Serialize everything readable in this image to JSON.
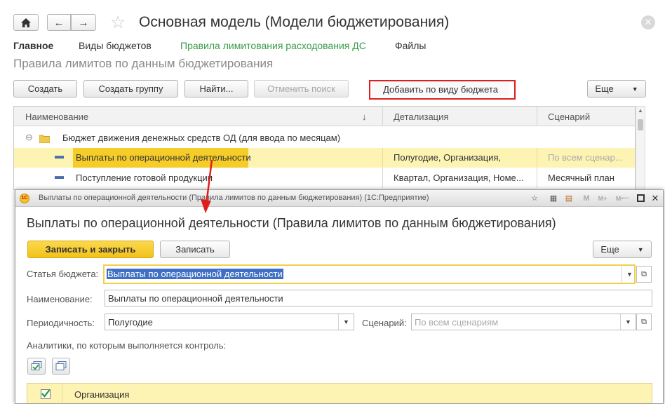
{
  "main_window": {
    "title": "Основная модель (Модели бюджетирования)",
    "nav": {
      "home_label": "Главное",
      "budget_types_label": "Виды  бюджетов",
      "limit_rules_label": "Правила лимитования расходования ДС",
      "files_label": "Файлы"
    },
    "subtitle": "Правила лимитов по данным бюджетирования",
    "toolbar": {
      "create": "Создать",
      "create_group": "Создать группу",
      "find": "Найти...",
      "cancel_search": "Отменить поиск",
      "add_by_budget_type": "Добавить по виду бюджета",
      "more": "Еще"
    },
    "table": {
      "columns": [
        "Наименование",
        "Детализация",
        "Сценарий"
      ],
      "sort_indicator": "↓",
      "group_row": "Бюджет движения денежных средств ОД (для ввода по месяцам)",
      "rows": [
        {
          "name": "Выплаты по операционной деятельности",
          "detail": "Полугодие, Организация,",
          "scenario": "По всем сценар..."
        },
        {
          "name": "Поступление готовой продукции",
          "detail": "Квартал, Организация, Номе...",
          "scenario": "Месячный план"
        }
      ]
    }
  },
  "dialog": {
    "window_title": "Выплаты по операционной деятельности (Правила лимитов по данным бюджетирования)  (1С:Предприятие)",
    "heading": "Выплаты по операционной деятельности (Правила лимитов по данным бюджетирования)",
    "buttons": {
      "save_close": "Записать и закрыть",
      "save": "Записать",
      "more": "Еще"
    },
    "fields": {
      "budget_item_label": "Статья бюджета:",
      "budget_item_value": "Выплаты по операционной деятельности",
      "name_label": "Наименование:",
      "name_value": "Выплаты по операционной деятельности",
      "periodicity_label": "Периодичность:",
      "periodicity_value": "Полугодие",
      "scenario_label": "Сценарий:",
      "scenario_placeholder": "По всем сценариям"
    },
    "analytics_label": "Аналитики, по которым выполняется контроль:",
    "analytics_rows": [
      {
        "checked": true,
        "name": "Организация"
      }
    ]
  },
  "colors": {
    "accent_green": "#3a9b4a",
    "selection_yellow": "#fbe97a",
    "selection_row": "#fdf3b3",
    "primary_button": "#f6cc28",
    "highlight_red": "#e01c1c",
    "text_selection": "#3f6fc6"
  },
  "icons": {
    "home": "home-icon",
    "back": "arrow-left-icon",
    "forward": "arrow-right-icon",
    "favorite": "star-icon",
    "close": "close-icon",
    "folder": "folder-icon",
    "checkbox": "checkbox-checked-icon"
  }
}
